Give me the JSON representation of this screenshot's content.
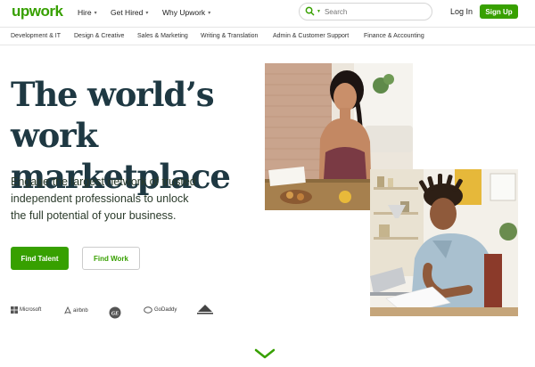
{
  "header": {
    "logo": "upwork",
    "nav": [
      {
        "label": "Hire"
      },
      {
        "label": "Get Hired"
      },
      {
        "label": "Why Upwork"
      }
    ],
    "search_placeholder": "Search",
    "login_label": "Log In",
    "signup_label": "Sign Up"
  },
  "categories": [
    "Development & IT",
    "Design & Creative",
    "Sales & Marketing",
    "Writing & Translation",
    "Admin & Customer Support",
    "Finance & Accounting"
  ],
  "hero": {
    "title_line1": "The world’s work",
    "title_line2": "marketplace",
    "subtitle_line1": "Engage the largest network of trusted",
    "subtitle_line2": "independent professionals to unlock",
    "subtitle_line3": "the full potential of your business.",
    "find_talent_label": "Find Talent",
    "find_work_label": "Find Work"
  },
  "brands": [
    "Microsoft",
    "airbnb",
    "GE",
    "GoDaddy",
    "Automattic"
  ],
  "colors": {
    "brand_green": "#37a000",
    "title_dark": "#1e3842"
  },
  "icons": {
    "search": "search-icon",
    "scroll": "chevron-down-icon"
  }
}
